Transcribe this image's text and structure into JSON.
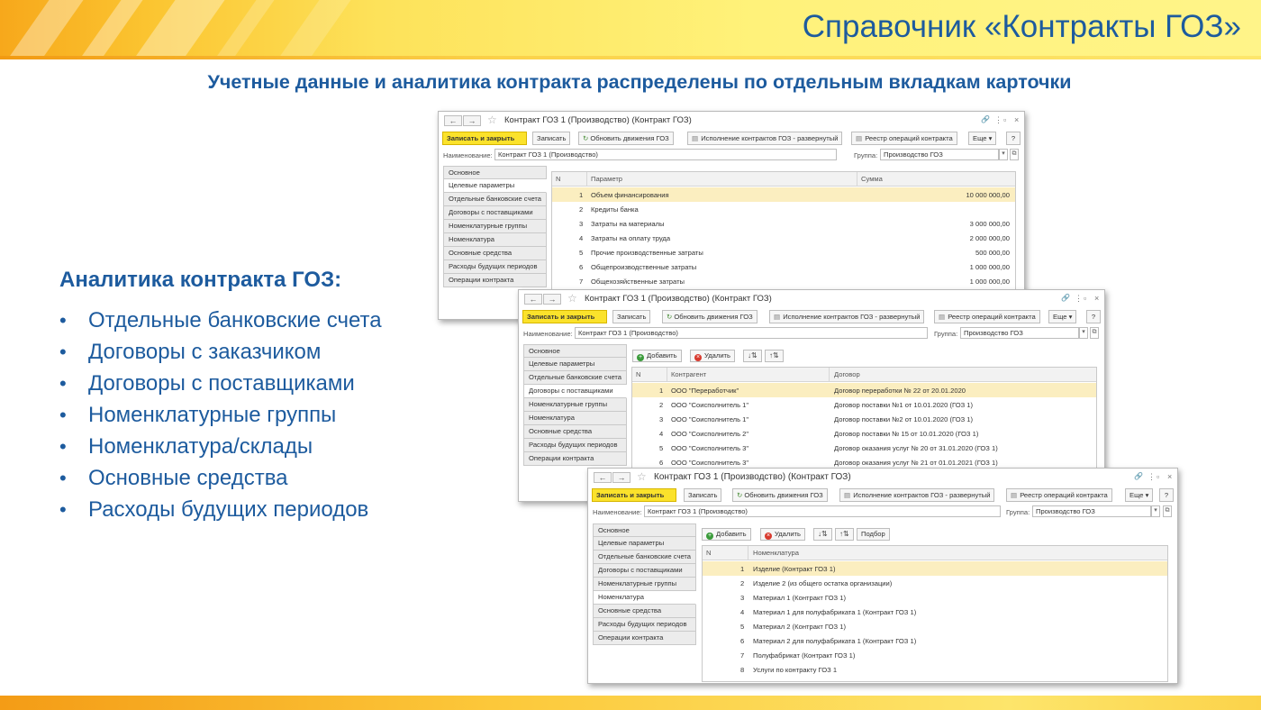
{
  "header": {
    "title": "Справочник «Контракты ГОЗ»"
  },
  "subtitle": "Учетные данные и аналитика контракта распределены по отдельным вкладкам карточки",
  "analytics": {
    "heading": "Аналитика контракта ГОЗ:",
    "items": [
      "Отдельные банковские счета",
      "Договоры с заказчиком",
      "Договоры с поставщиками",
      "Номенклатурные группы",
      "Номенклатура/склады",
      "Основные средства",
      "Расходы будущих периодов"
    ]
  },
  "form": {
    "window_title": "Контракт ГОЗ 1 (Производство) (Контракт ГОЗ)",
    "back": "←",
    "forward": "→",
    "link_icon": "🔗",
    "more_icon": "⋮",
    "restore_icon": "▫",
    "close_icon": "×",
    "btn_save_close": "Записать и закрыть",
    "btn_save": "Записать",
    "btn_update": "Обновить движения ГОЗ",
    "btn_execution": "Исполнение контрактов ГОЗ - развернутый",
    "btn_registry": "Реестр операций контракта",
    "btn_more": "Еще",
    "btn_help": "?",
    "name_label": "Наименование:",
    "name_value": "Контракт ГОЗ 1 (Производство)",
    "group_label": "Группа:",
    "group_value": "Производство ГОЗ",
    "add": "Добавить",
    "delete": "Удалить",
    "pick": "Подбор",
    "col_n": "N",
    "tabs": [
      "Основное",
      "Целевые параметры",
      "Отдельные банковские счета",
      "Договоры с поставщиками",
      "Номенклатурные группы",
      "Номенклатура",
      "Основные средства",
      "Расходы будущих периодов",
      "Операции контракта"
    ]
  },
  "win1": {
    "col_param": "Параметр",
    "col_sum": "Сумма",
    "rows": [
      {
        "n": "1",
        "param": "Объем финансирования",
        "sum": "10 000 000,00"
      },
      {
        "n": "2",
        "param": "Кредиты банка",
        "sum": ""
      },
      {
        "n": "3",
        "param": "Затраты на материалы",
        "sum": "3 000 000,00"
      },
      {
        "n": "4",
        "param": "Затраты на оплату труда",
        "sum": "2 000 000,00"
      },
      {
        "n": "5",
        "param": "Прочие производственные затраты",
        "sum": "500 000,00"
      },
      {
        "n": "6",
        "param": "Общепроизводственные затраты",
        "sum": "1 000 000,00"
      },
      {
        "n": "7",
        "param": "Общехозяйственные затраты",
        "sum": "1 000 000,00"
      }
    ]
  },
  "win2": {
    "col_contractor": "Контрагент",
    "col_contract": "Договор",
    "rows": [
      {
        "n": "1",
        "contractor": "ООО \"Переработчик\"",
        "contract": "Договор переработки № 22 от 20.01.2020"
      },
      {
        "n": "2",
        "contractor": "ООО \"Соисполнитель 1\"",
        "contract": "Договор поставки №1 от 10.01.2020 (ГОЗ 1)"
      },
      {
        "n": "3",
        "contractor": "ООО \"Соисполнитель 1\"",
        "contract": "Договор поставки №2 от 10.01.2020 (ГОЗ 1)"
      },
      {
        "n": "4",
        "contractor": "ООО \"Соисполнитель 2\"",
        "contract": "Договор поставки № 15 от 10.01.2020 (ГОЗ 1)"
      },
      {
        "n": "5",
        "contractor": "ООО \"Соисполнитель 3\"",
        "contract": "Договор оказания услуг № 20 от 31.01.2020 (ГОЗ 1)"
      },
      {
        "n": "6",
        "contractor": "ООО \"Соисполнитель 3\"",
        "contract": "Договор оказания услуг № 21 от 01.01.2021 (ГОЗ 1)"
      }
    ]
  },
  "win3": {
    "col_nom": "Номенклатура",
    "rows": [
      {
        "n": "1",
        "nom": "Изделие (Контракт ГОЗ 1)"
      },
      {
        "n": "2",
        "nom": "Изделие 2 (из общего остатка организации)"
      },
      {
        "n": "3",
        "nom": "Материал 1 (Контракт ГОЗ 1)"
      },
      {
        "n": "4",
        "nom": "Материал 1 для полуфабриката 1 (Контракт ГОЗ 1)"
      },
      {
        "n": "5",
        "nom": "Материал 2 (Контракт ГОЗ 1)"
      },
      {
        "n": "6",
        "nom": "Материал 2 для полуфабриката 1 (Контракт ГОЗ 1)"
      },
      {
        "n": "7",
        "nom": "Полуфабрикат (Контракт ГОЗ 1)"
      },
      {
        "n": "8",
        "nom": "Услуги по контракту ГОЗ 1"
      }
    ]
  }
}
